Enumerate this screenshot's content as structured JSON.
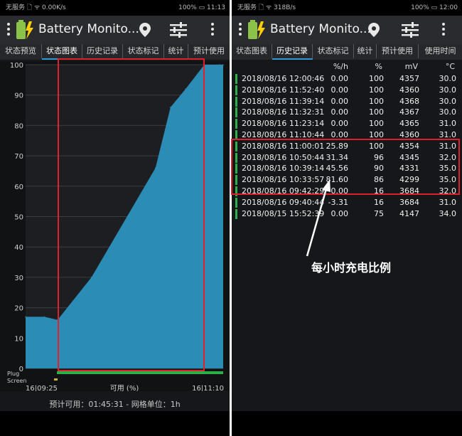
{
  "left_screen": {
    "status": {
      "left": "无服务 🗋 ᯤ 0.00K/s",
      "right": "100% ▭ 11:13"
    },
    "app_title": "Battery Monito...",
    "tabs": [
      "状态预览",
      "状态图表",
      "历史记录",
      "状态标记",
      "统计",
      "预计使用"
    ],
    "active_tab": "状态图表",
    "chart_data": {
      "type": "area",
      "title": "",
      "xlabel": "可用 (%)",
      "ylabel": "",
      "ylim": [
        0,
        100
      ],
      "yticks": [
        "0",
        "10",
        "20",
        "30",
        "40",
        "50",
        "60",
        "70",
        "80",
        "90",
        "100"
      ],
      "x_start_label": "16|09:25",
      "x_end_label": "16|11:10",
      "x_range": [
        "09:25",
        "11:10"
      ],
      "series": [
        {
          "x": [
            "09:25",
            "09:35",
            "09:42",
            "10:00",
            "10:34",
            "10:42",
            "10:50",
            "11:00",
            "11:08",
            "11:10"
          ],
          "values": [
            17,
            17,
            16,
            30,
            66,
            86,
            92,
            100,
            100,
            100
          ]
        }
      ],
      "track_labels": [
        "Plug",
        "Screen"
      ],
      "fill_color": "#2b8db6",
      "plug_color": "#2bb04a",
      "screen_color": "#c9b630"
    },
    "footer": "预计可用：01:45:31 - 网格单位：1h"
  },
  "right_screen": {
    "status": {
      "left": "无服务 🗋 ᯤ 318B/s",
      "right": "100% ▭ 12:00"
    },
    "app_title": "Battery Monito...",
    "tabs": [
      "状态图表",
      "历史记录",
      "状态标记",
      "统计",
      "预计使用",
      "使用时间"
    ],
    "active_tab": "历史记录",
    "table": {
      "columns": [
        "",
        "%/h",
        "%",
        "mV",
        "°C"
      ],
      "rows": [
        [
          "2018/08/16 12:00:46",
          "0.00",
          "100",
          "4357",
          "30.0"
        ],
        [
          "2018/08/16 11:52:40",
          "0.00",
          "100",
          "4360",
          "30.0"
        ],
        [
          "2018/08/16 11:39:14",
          "0.00",
          "100",
          "4368",
          "30.0"
        ],
        [
          "2018/08/16 11:32:31",
          "0.00",
          "100",
          "4367",
          "30.0"
        ],
        [
          "2018/08/16 11:23:14",
          "0.00",
          "100",
          "4365",
          "31.0"
        ],
        [
          "2018/08/16 11:10:44",
          "0.00",
          "100",
          "4360",
          "31.0"
        ],
        [
          "2018/08/16 11:00:01",
          "25.89",
          "100",
          "4354",
          "31.0"
        ],
        [
          "2018/08/16 10:50:44",
          "31.34",
          "96",
          "4345",
          "32.0"
        ],
        [
          "2018/08/16 10:39:14",
          "45.56",
          "90",
          "4331",
          "35.0"
        ],
        [
          "2018/08/16 10:33:57",
          "81.60",
          "86",
          "4299",
          "35.0"
        ],
        [
          "2018/08/16 09:42:29",
          "0.00",
          "16",
          "3684",
          "32.0"
        ],
        [
          "2018/08/16 09:40:44",
          "-3.31",
          "16",
          "3684",
          "31.0"
        ],
        [
          "2018/08/15 15:52:39",
          "0.00",
          "75",
          "4147",
          "34.0"
        ]
      ]
    }
  },
  "annotation": "每小时充电比例",
  "colors": {
    "highlight": "#e0202a",
    "accent": "#2e9bd6",
    "arrow": "#ffffff"
  }
}
